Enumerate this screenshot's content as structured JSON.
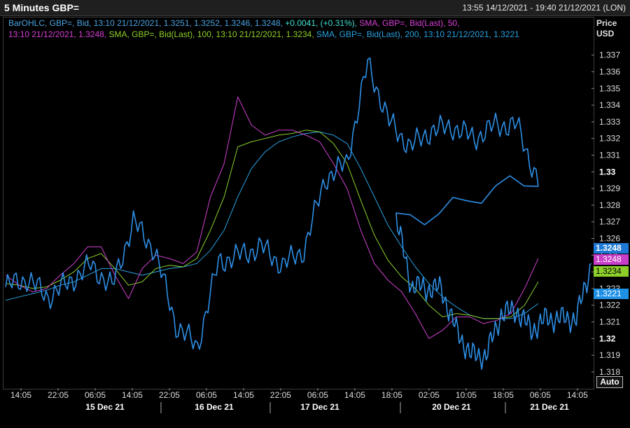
{
  "window": {
    "title": "5 Minutes GBP=",
    "range": "13:55 14/12/2021 - 19:40 21/12/2021 (LON)"
  },
  "legend": {
    "line1": [
      {
        "text": "BarOHLC, GBP=, Bid, 13:10 21/12/2021, 1.3251, 1.3252, 1.3246, 1.3248, ",
        "color": "#4aa3df"
      },
      {
        "text": "+0.0041, (+0.31%), ",
        "color": "#3fe0d0"
      },
      {
        "text": "SMA, GBP=, Bid(Last),  50,",
        "color": "#d63fd6"
      }
    ],
    "line2": [
      {
        "text": "13:10 21/12/2021, 1.3248, ",
        "color": "#d63fd6"
      },
      {
        "text": "SMA, GBP=, Bid(Last),  100,  13:10 21/12/2021, 1.3234, ",
        "color": "#8fd12a"
      },
      {
        "text": "SMA, GBP=, Bid(Last),  200,  13:10 21/12/2021, 1.3221",
        "color": "#2aa0e0"
      }
    ]
  },
  "y_axis": {
    "label_line1": "Price",
    "label_line2": "USD"
  },
  "auto_button": "Auto",
  "chart_data": {
    "type": "line",
    "xlabel": "",
    "ylabel": "Price USD",
    "ylim": [
      1.3172,
      1.3377
    ],
    "yticks": [
      "1.337",
      "1.336",
      "1.335",
      "1.334",
      "1.333",
      "1.332",
      "1.331",
      "1.33",
      "1.329",
      "1.328",
      "1.327",
      "1.326",
      "1.325",
      "1.324",
      "1.323",
      "1.322",
      "1.321",
      "1.32",
      "1.319",
      "1.318"
    ],
    "ytick_values": [
      1.337,
      1.336,
      1.335,
      1.334,
      1.333,
      1.332,
      1.331,
      1.33,
      1.329,
      1.328,
      1.327,
      1.326,
      1.325,
      1.324,
      1.323,
      1.322,
      1.321,
      1.32,
      1.319,
      1.318
    ],
    "bold_yticks": [
      "1.33",
      "1.32"
    ],
    "grid": false,
    "xticks": [
      "14:05",
      "22:05",
      "06:05",
      "14:05",
      "22:05",
      "06:05",
      "14:05",
      "22:05",
      "06:05",
      "14:05",
      "18:05",
      "02:05",
      "10:05",
      "18:05",
      "06:05",
      "14:05"
    ],
    "day_labels": [
      "15 Dec 21",
      "16 Dec 21",
      "17 Dec 21",
      "20 Dec 21",
      "21 Dec 21"
    ],
    "x_index": [
      0,
      4,
      8,
      12,
      16,
      20,
      24,
      28,
      32,
      36,
      40,
      44,
      48,
      52,
      56,
      60,
      64,
      68,
      72,
      76,
      80,
      84,
      88,
      92,
      96,
      100
    ],
    "series": [
      {
        "name": "BarOHLC, GBP=, Bid",
        "color": "#2e8fe6",
        "values": [
          1.3231,
          1.3236,
          1.3225,
          1.3234,
          1.3244,
          1.3231,
          1.327,
          1.3253,
          1.3208,
          1.3195,
          1.3246,
          1.325,
          1.3255,
          1.3244,
          1.3253,
          1.3296,
          1.3305,
          1.3365,
          1.333,
          1.3315,
          1.3325,
          1.3327,
          1.332,
          1.3328,
          1.3328,
          1.3294,
          1.3272,
          1.3232,
          1.323,
          1.323,
          1.3205,
          1.319,
          1.319,
          1.3215,
          1.3217,
          1.3205,
          1.3212,
          1.3212,
          1.3212,
          1.3245
        ]
      },
      {
        "name": "SMA, GBP=, Bid(Last), 50",
        "color": "#d040d0",
        "values": [
          1.3238,
          1.3232,
          1.3228,
          1.323,
          1.3238,
          1.3245,
          1.3255,
          1.3255,
          1.3238,
          1.3224,
          1.3242,
          1.325,
          1.3248,
          1.3245,
          1.3252,
          1.3285,
          1.3305,
          1.3345,
          1.3328,
          1.3322,
          1.3325,
          1.3325,
          1.3322,
          1.3318,
          1.3305,
          1.329,
          1.3265,
          1.3245,
          1.3235,
          1.3228,
          1.3215,
          1.32,
          1.3205,
          1.3213,
          1.3213,
          1.3209,
          1.3211,
          1.3215,
          1.323,
          1.3248
        ]
      },
      {
        "name": "SMA, GBP=, Bid(Last), 100",
        "color": "#8ccf2a",
        "values": [
          1.3233,
          1.3232,
          1.323,
          1.3231,
          1.3235,
          1.324,
          1.3248,
          1.3251,
          1.3242,
          1.3232,
          1.3234,
          1.3242,
          1.3244,
          1.3243,
          1.3248,
          1.3265,
          1.3285,
          1.3315,
          1.3318,
          1.332,
          1.3322,
          1.3323,
          1.3325,
          1.3324,
          1.3317,
          1.3305,
          1.3283,
          1.3262,
          1.3247,
          1.3237,
          1.323,
          1.322,
          1.3213,
          1.3215,
          1.3214,
          1.3212,
          1.3212,
          1.3213,
          1.322,
          1.3234
        ]
      },
      {
        "name": "SMA, GBP=, Bid(Last), 200",
        "color": "#2aa0e0",
        "values": [
          1.3223,
          1.3225,
          1.3227,
          1.3229,
          1.3232,
          1.3234,
          1.3238,
          1.3242,
          1.3242,
          1.324,
          1.3238,
          1.324,
          1.3242,
          1.3243,
          1.3245,
          1.3253,
          1.3265,
          1.3285,
          1.3302,
          1.3312,
          1.3318,
          1.3321,
          1.3323,
          1.3324,
          1.3322,
          1.3317,
          1.3302,
          1.3285,
          1.3268,
          1.3255,
          1.3243,
          1.3233,
          1.3225,
          1.3219,
          1.3214,
          1.3212,
          1.3212,
          1.3212,
          1.3215,
          1.3221
        ]
      }
    ],
    "price_tags": [
      {
        "value": 1.3248,
        "label": "1.3248",
        "bg": "#1e7ad6",
        "fg": "#ffffff",
        "series": "BarOHLC"
      },
      {
        "value": 1.32475,
        "label": "1.3248",
        "bg": "#c83ec8",
        "fg": "#ffffff",
        "series": "SMA 50"
      },
      {
        "value": 1.3234,
        "label": "1.3234",
        "bg": "#8ccf2a",
        "fg": "#000000",
        "series": "SMA 100"
      },
      {
        "value": 1.3221,
        "label": "1.3221",
        "bg": "#1e90e6",
        "fg": "#ffffff",
        "series": "SMA 200"
      }
    ]
  }
}
